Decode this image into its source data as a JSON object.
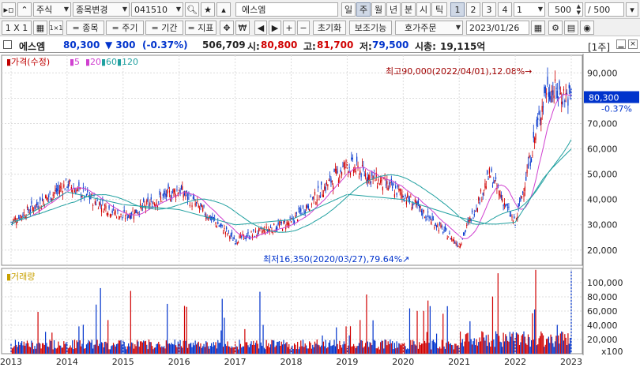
{
  "toolbar1": {
    "market": "주식",
    "change_label": "종목변경",
    "code": "041510",
    "stock_name": "에스엠",
    "period_tabs": [
      "일",
      "주",
      "월",
      "년",
      "분",
      "시",
      "틱"
    ],
    "number_tabs": [
      "1",
      "2",
      "3",
      "4"
    ],
    "num_combo": "1",
    "count_value": "500",
    "count_display": "/ 500"
  },
  "toolbar2": {
    "scale": "1 X 1",
    "stock_label": "= 종목",
    "period_label": "= 주기",
    "range_label": "= 기간",
    "indicator_label": "= 지표",
    "reset_label": "초기화",
    "aux_label": "보조기능",
    "order_label": "호가주문",
    "date": "2023/01/26"
  },
  "infobar": {
    "name": "에스엠",
    "price": "80,300",
    "change": "▼ 300",
    "change_pct": "(-0.37%)",
    "volume": "506,709",
    "open_label": "시:",
    "open": "80,800",
    "high_label": "고:",
    "high": "81,700",
    "low_label": "저:",
    "low": "79,500",
    "cap_label": "시총:",
    "cap": "19,115억",
    "unit": "[1주]"
  },
  "chart_data": [
    {
      "type": "line",
      "legend": [
        "가격(수정)",
        "5",
        "20",
        "60",
        "120"
      ],
      "legend_colors": [
        "#c00000",
        "#d040d0",
        "#d040d0",
        "#20a0a0",
        "#20a0a0"
      ],
      "x": [
        "2013",
        "2014",
        "2015",
        "2016",
        "2017",
        "2018",
        "2019",
        "2020",
        "2021",
        "2022",
        "2023"
      ],
      "y_ticks": [
        20000,
        30000,
        40000,
        50000,
        60000,
        70000,
        80000,
        90000
      ],
      "y_tick_labels": [
        "20,000",
        "30,000",
        "40,000",
        "50,000",
        "60,000",
        "70,000",
        "80,000",
        "90,000"
      ],
      "ylim": [
        14000,
        97000
      ],
      "series": [
        {
          "name": "가격(수정)",
          "values": [
            31000,
            46000,
            33000,
            44000,
            24000,
            31000,
            54000,
            42000,
            22000,
            50000,
            30000,
            84000,
            80300
          ]
        },
        {
          "name": "120",
          "values": [
            30000,
            43000,
            38000,
            36000,
            30000,
            32000,
            42000,
            40000,
            33000,
            30000,
            31000,
            50000,
            60000
          ]
        }
      ],
      "series_x": [
        "2013",
        "2014",
        "2015",
        "2016",
        "2017",
        "2018",
        "2019",
        "2020",
        "2021",
        "2021",
        "2022",
        "2022",
        "2023"
      ],
      "last_price_label": "80,300",
      "last_change_label": "-0.37%",
      "annotations": {
        "high": "최고90,000(2022/04/01),12.08%",
        "low": "최저16,350(2020/03/27),79.64%"
      }
    },
    {
      "type": "bar",
      "legend": [
        "거래량"
      ],
      "y_ticks": [
        20000,
        40000,
        60000,
        80000,
        100000
      ],
      "y_tick_labels": [
        "20,000",
        "40,000",
        "60,000",
        "80,000",
        "100,000"
      ],
      "unit": "x100",
      "ylim": [
        0,
        120000
      ]
    }
  ]
}
